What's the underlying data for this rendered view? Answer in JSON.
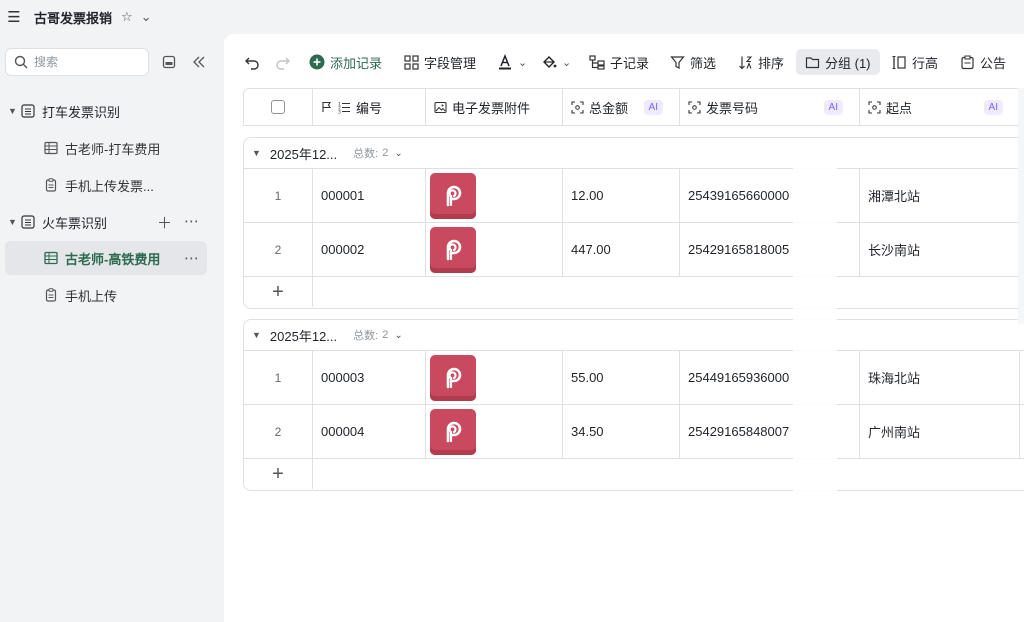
{
  "app": {
    "title": "古哥发票报销"
  },
  "sidebar": {
    "search_placeholder": "搜索",
    "items": [
      {
        "label": "打车发票识别",
        "type": "folder",
        "expanded": true
      },
      {
        "label": "古老师-打车费用",
        "type": "table"
      },
      {
        "label": "手机上传发票...",
        "type": "form"
      },
      {
        "label": "火车票识别",
        "type": "folder",
        "expanded": true
      },
      {
        "label": "古老师-高铁费用",
        "type": "table",
        "active": true
      },
      {
        "label": "手机上传",
        "type": "form"
      }
    ]
  },
  "toolbar": {
    "add_record": "添加记录",
    "field_manage": "字段管理",
    "sub_record": "子记录",
    "filter": "筛选",
    "sort": "排序",
    "group": "分组 (1)",
    "row_height": "行高",
    "notice": "公告"
  },
  "columns": [
    {
      "label": "编号",
      "icon": "index-icon"
    },
    {
      "label": "电子发票附件",
      "icon": "image-icon"
    },
    {
      "label": "总金额",
      "icon": "ai-scan-icon",
      "ai": "AI"
    },
    {
      "label": "发票号码",
      "icon": "ai-scan-icon",
      "ai": "AI"
    },
    {
      "label": "起点",
      "icon": "ai-scan-icon",
      "ai": "AI"
    }
  ],
  "groups": [
    {
      "title": "2025年12...",
      "count_label": "总数:",
      "count": "2",
      "rows": [
        {
          "idx": "1",
          "code": "000001",
          "amount": "12.00",
          "invoice": "25439165660000",
          "start": "湘潭北站"
        },
        {
          "idx": "2",
          "code": "000002",
          "amount": "447.00",
          "invoice": "25429165818005",
          "start": "长沙南站"
        }
      ]
    },
    {
      "title": "2025年12...",
      "count_label": "总数:",
      "count": "2",
      "rows": [
        {
          "idx": "1",
          "code": "000003",
          "amount": "55.00",
          "invoice": "25449165936000",
          "start": "珠海北站"
        },
        {
          "idx": "2",
          "code": "000004",
          "amount": "34.50",
          "invoice": "25429165848007",
          "start": "广州南站"
        }
      ]
    }
  ],
  "colors": {
    "accent": "#2d6a4f",
    "attachment": "#c94a5e",
    "ai_badge": "#7b61ff"
  }
}
